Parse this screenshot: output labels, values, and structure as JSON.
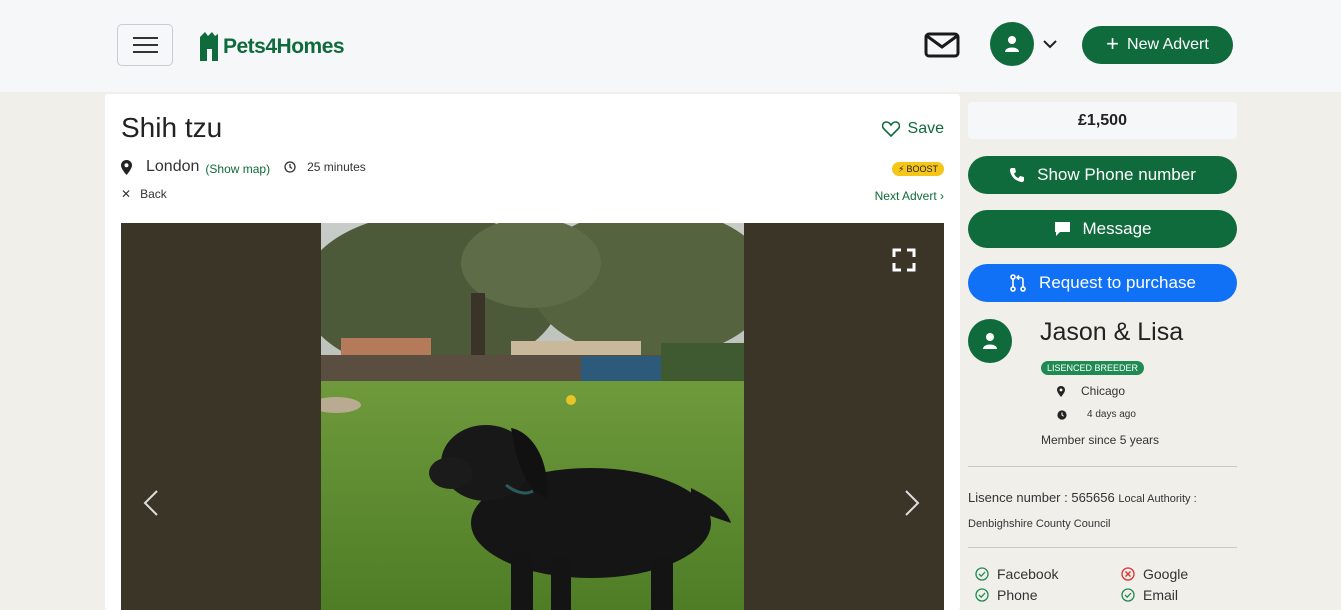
{
  "header": {
    "logo_text": "Pets4Homes",
    "new_advert_label": "New Advert",
    "brand_color": "#0f6b3c"
  },
  "listing": {
    "title": "Shih tzu",
    "save_label": "Save",
    "location": "London",
    "show_map_label": "(Show map)",
    "posted": "25 minutes",
    "boost_label": "BOOST",
    "back_label": "Back",
    "next_label": "Next Advert ›"
  },
  "sidebar": {
    "price": "£1,500",
    "show_phone_label": "Show Phone number",
    "message_label": "Message",
    "request_label": "Request to purchase",
    "seller": {
      "name": "Jason & Lisa",
      "badge": "LISENCED BREEDER",
      "city": "Chicago",
      "last_seen": "4 days ago",
      "member_since": "Member since 5 years"
    },
    "licence_label": "Lisence number : ",
    "licence_number": "565656",
    "authority_label": "Local Authority :",
    "authority": "Denbighshire County Council",
    "verifications": [
      {
        "label": "Facebook",
        "status": "verified"
      },
      {
        "label": "Google",
        "status": "not-verified"
      },
      {
        "label": "Phone",
        "status": "verified"
      },
      {
        "label": "Email",
        "status": "verified"
      }
    ]
  }
}
